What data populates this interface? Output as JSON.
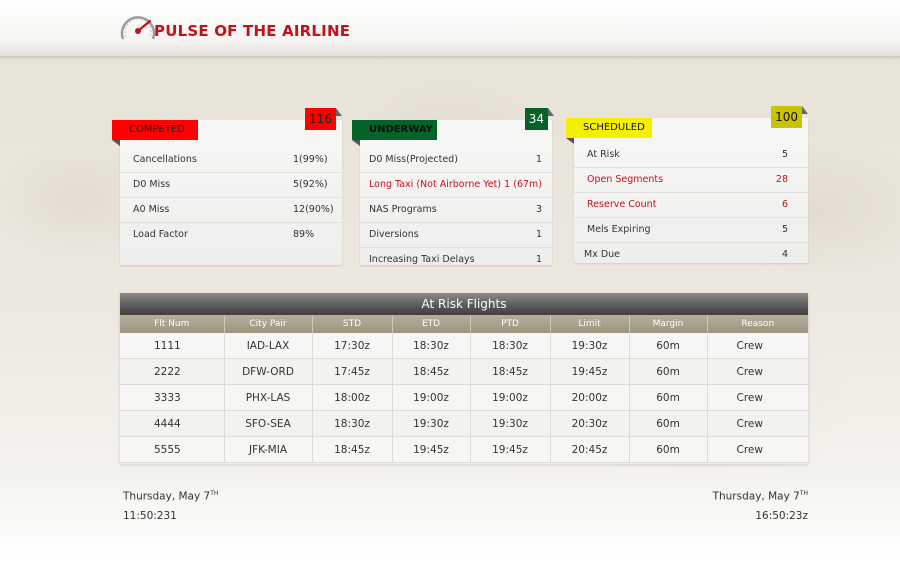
{
  "app": {
    "title": "PULSE OF THE AIRLINE"
  },
  "colors": {
    "brand": "#c4101a",
    "completed": "#ff0000",
    "underway": "#05632a",
    "scheduled": "#f5f000",
    "alert_text": "#c8101a"
  },
  "icons": {
    "logo": "speedometer-icon"
  },
  "panels": [
    {
      "title": "COMPETED",
      "count": "116",
      "rows": [
        {
          "label": "Cancellations",
          "value": "1(99%)"
        },
        {
          "label": "D0 Miss",
          "value": "5(92%)"
        },
        {
          "label": "A0 Miss",
          "value": "12(90%)"
        },
        {
          "label": "Load Factor",
          "value": "89%"
        }
      ]
    },
    {
      "title": "UNDERWAY",
      "count": "34",
      "rows": [
        {
          "label": "D0 Miss(Projected)",
          "value": "1"
        },
        {
          "label": "Long Taxi (Not Airborne Yet)",
          "value": "1 (67m)"
        },
        {
          "label": "NAS Programs",
          "value": "3"
        },
        {
          "label": "Diversions",
          "value": "1"
        },
        {
          "label": "Increasing Taxi Delays",
          "value": "1"
        }
      ]
    },
    {
      "title": "SCHEDULED",
      "count": "100",
      "rows": [
        {
          "label": "At Risk",
          "value": "5"
        },
        {
          "label": "Open Segments",
          "value": "28"
        },
        {
          "label": "Reserve Count",
          "value": "6"
        },
        {
          "label": "Mels Expiring",
          "value": "5"
        },
        {
          "label": "Mx Due",
          "value": "4"
        }
      ]
    }
  ],
  "at_risk": {
    "title": "At Risk Flights",
    "columns": [
      "Flt Num",
      "City Pair",
      "STD",
      "ETD",
      "PTD",
      "Limit",
      "Margin",
      "Reason"
    ],
    "rows": [
      [
        "1111",
        "IAD-LAX",
        "17:30z",
        "18:30z",
        "18:30z",
        "19:30z",
        "60m",
        "Crew"
      ],
      [
        "2222",
        "DFW-ORD",
        "17:45z",
        "18:45z",
        "18:45z",
        "19:45z",
        "60m",
        "Crew"
      ],
      [
        "3333",
        "PHX-LAS",
        "18:00z",
        "19:00z",
        "19:00z",
        "20:00z",
        "60m",
        "Crew"
      ],
      [
        "4444",
        "SFO-SEA",
        "18:30z",
        "19:30z",
        "19:30z",
        "20:30z",
        "60m",
        "Crew"
      ],
      [
        "5555",
        "JFK-MIA",
        "18:45z",
        "19:45z",
        "19:45z",
        "20:45z",
        "60m",
        "Crew"
      ]
    ]
  },
  "footer": {
    "left": {
      "date": "Thursday, May 7",
      "suffix": "TH",
      "time": "11:50:231"
    },
    "right": {
      "date": "Thursday, May 7",
      "suffix": "TH",
      "time": "16:50:23z"
    }
  }
}
